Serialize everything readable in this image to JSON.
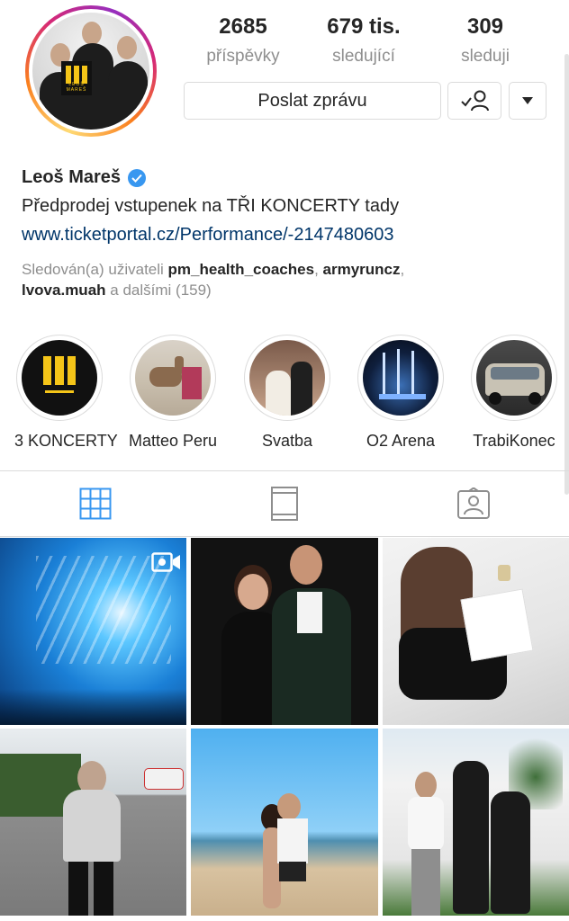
{
  "profile": {
    "name": "Leoš Mareš",
    "bio": "Předprodej vstupenek na TŘI KONCERTY tady",
    "link": "www.ticketportal.cz/Performance/-2147480603",
    "followed_prefix": "Sledován(a) uživateli",
    "followed_user1": "pm_health_coaches",
    "followed_sep": ",",
    "followed_user2": "armyruncz",
    "followed_user3": "lvova.muah",
    "followed_suffix": "a dalšími (159)",
    "avatar_logo_text": "LEOŠ MAREŠ"
  },
  "stats": [
    {
      "value": "2685",
      "label": "příspěvky"
    },
    {
      "value": "679 tis.",
      "label": "sledující"
    },
    {
      "value": "309",
      "label": "sleduji"
    }
  ],
  "actions": {
    "message_label": "Poslat zprávu"
  },
  "highlights": [
    {
      "label": "3 KONCERTY"
    },
    {
      "label": "Matteo Peru"
    },
    {
      "label": "Svatba"
    },
    {
      "label": "O2 Arena"
    },
    {
      "label": "TrabiKonec"
    }
  ],
  "tabs": [
    "grid-view",
    "feed-view",
    "tagged-view"
  ],
  "colors": {
    "link": "#003569",
    "verified": "#3897f0",
    "active_tab": "#3897f0",
    "muted": "#8e8e8e"
  }
}
